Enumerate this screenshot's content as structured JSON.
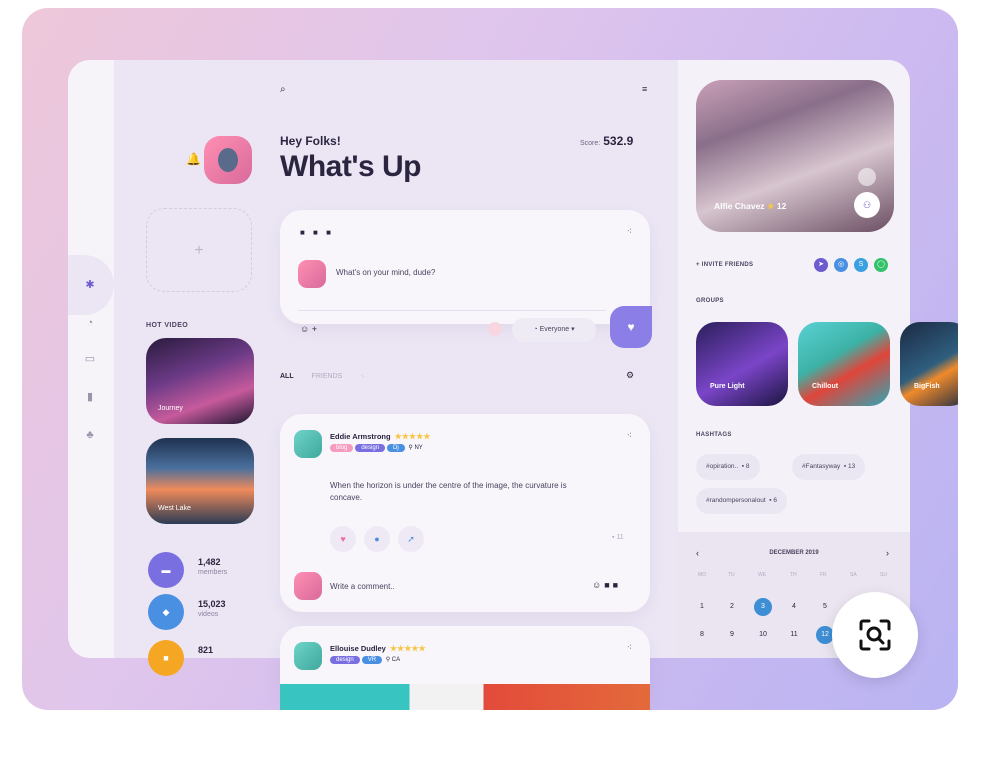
{
  "left": {
    "hot_video_label": "HOT VIDEO",
    "videos": [
      {
        "title": "Journey"
      },
      {
        "title": "West Lake"
      }
    ],
    "stats": [
      {
        "value": "1,482",
        "label": "members",
        "color": "#7a6fe0"
      },
      {
        "value": "15,023",
        "label": "videos",
        "color": "#4a90e2"
      },
      {
        "value": "821",
        "label": "",
        "color": "#f5a623"
      }
    ]
  },
  "header": {
    "greeting": "Hey Folks!",
    "title": "What's Up",
    "score_label": "Score:",
    "score_value": "532.9"
  },
  "composer": {
    "placeholder": "What's on your mind, dude?",
    "audience": "Everyone"
  },
  "feed_tabs": [
    "ALL",
    "FRIENDS"
  ],
  "posts": [
    {
      "author": "Eddie Armstrong",
      "stars": "★★★★★",
      "tags": [
        "blog",
        "design",
        "Dj"
      ],
      "location": "NY",
      "text": "When the horizon is under the centre of the image, the curvature is concave.",
      "comment_count": "11",
      "comment_placeholder": "Write a comment.."
    },
    {
      "author": "Ellouise Dudley",
      "stars": "★★★★★",
      "tags": [
        "design",
        "VR"
      ],
      "location": "CA"
    }
  ],
  "profile": {
    "name": "Alfie Chavez",
    "rating": "12"
  },
  "invite_label": "+ INVITE FRIENDS",
  "groups_label": "GROUPS",
  "groups": [
    "Pure Light",
    "Chillout",
    "BigFish"
  ],
  "hashtags_label": "HASHTAGS",
  "hashtags": [
    {
      "tag": "#opiration..",
      "count": "8"
    },
    {
      "tag": "#Fantasyway",
      "count": "13"
    },
    {
      "tag": "#randompersonalout",
      "count": "6"
    }
  ],
  "calendar": {
    "month": "DECEMBER 2019",
    "weekdays": [
      "MO",
      "TU",
      "WE",
      "TH",
      "FR",
      "SA",
      "SU"
    ],
    "days_row1": [
      "1",
      "2",
      "3",
      "4",
      "5",
      "6",
      "7"
    ],
    "days_row2": [
      "8",
      "9",
      "10",
      "11",
      "12"
    ]
  }
}
